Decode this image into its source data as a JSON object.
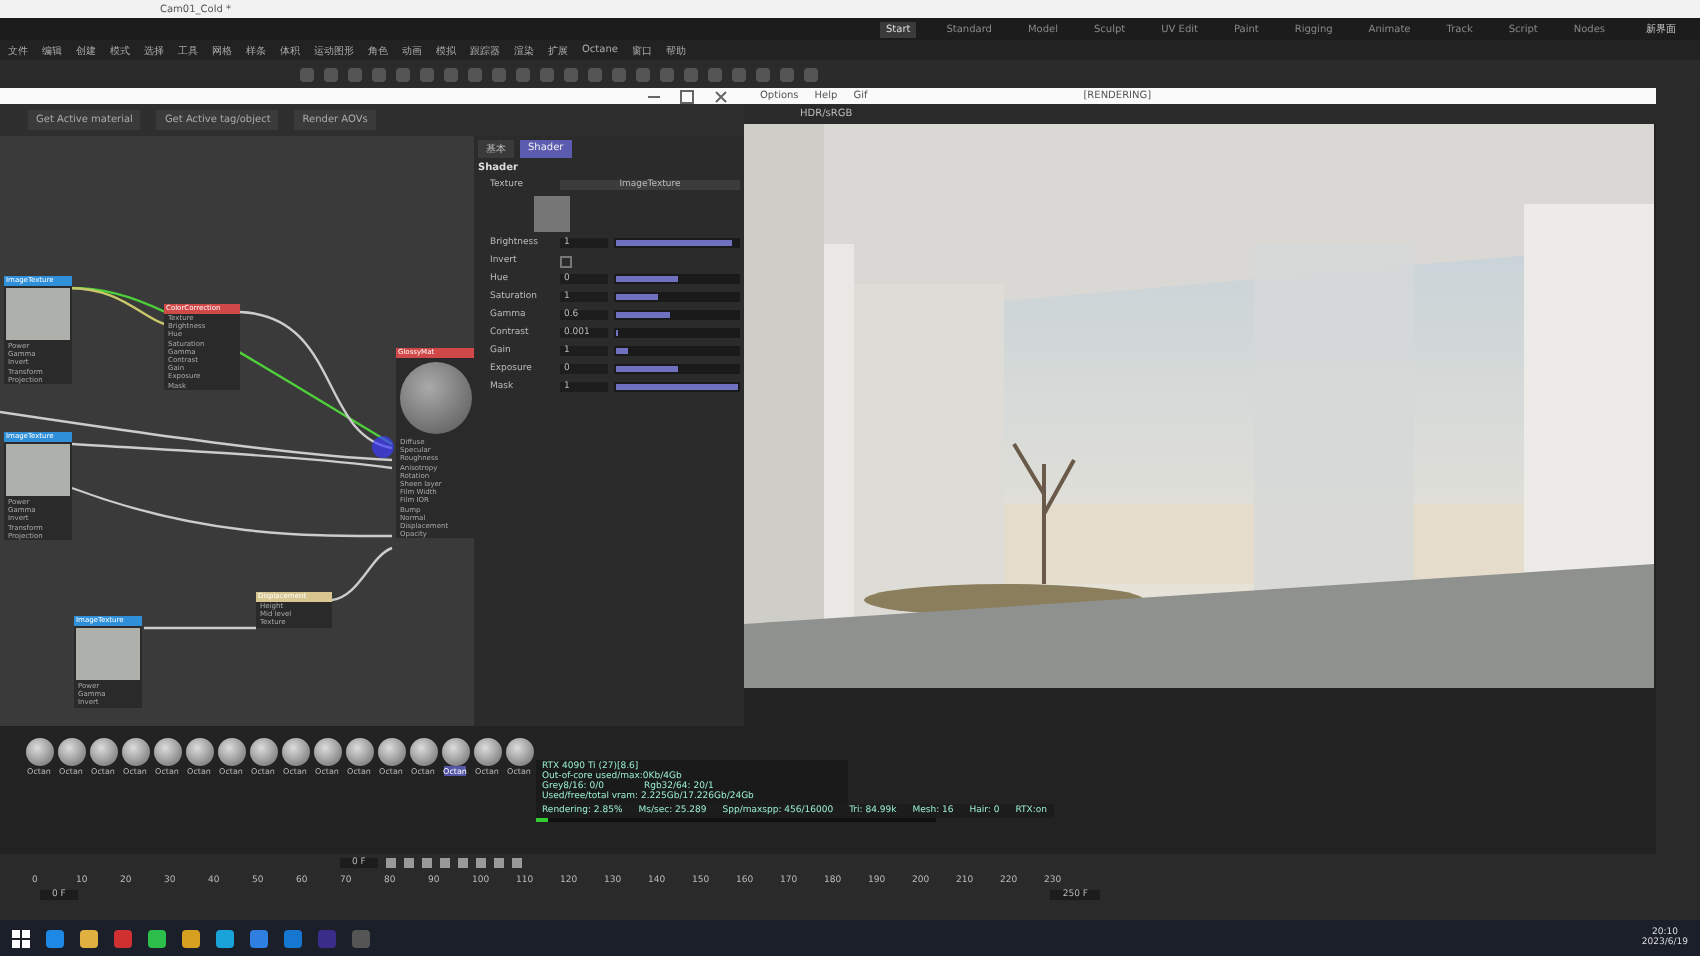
{
  "window": {
    "tab": "Cam01_Cold *"
  },
  "layouts": [
    {
      "label": "Start",
      "selected": true
    },
    {
      "label": "Standard",
      "selected": false
    },
    {
      "label": "Model",
      "selected": false
    },
    {
      "label": "Sculpt",
      "selected": false
    },
    {
      "label": "UV Edit",
      "selected": false
    },
    {
      "label": "Paint",
      "selected": false
    },
    {
      "label": "Rigging",
      "selected": false
    },
    {
      "label": "Animate",
      "selected": false
    },
    {
      "label": "Track",
      "selected": false
    },
    {
      "label": "Script",
      "selected": false
    },
    {
      "label": "Nodes",
      "selected": false
    }
  ],
  "layout_extra": "新界面",
  "menu": [
    "文件",
    "编辑",
    "创建",
    "模式",
    "选择",
    "工具",
    "网格",
    "样条",
    "体积",
    "运动图形",
    "角色",
    "动画",
    "模拟",
    "跟踪器",
    "渲染",
    "扩展",
    "Octane",
    "窗口",
    "帮助"
  ],
  "node_editor": {
    "buttons": [
      "Get Active material",
      "Get Active tag/object",
      "Render AOVs"
    ],
    "nodes": [
      {
        "title": "ImageTexture",
        "kind": "texture",
        "color": "#2f8fd8",
        "ports": [
          "Power",
          "Gamma",
          "Invert",
          "Transform",
          "Projection"
        ]
      },
      {
        "title": "ColorCorrection",
        "kind": "plain",
        "color": "#d04848",
        "ports": [
          "Texture",
          "Brightness",
          "Hue",
          "Saturation",
          "Gamma",
          "Contrast",
          "Gain",
          "Exposure",
          "Mask"
        ]
      },
      {
        "title": "ImageTexture",
        "kind": "texture",
        "color": "#2f8fd8",
        "ports": [
          "Power",
          "Gamma",
          "Invert",
          "Transform",
          "Projection"
        ]
      },
      {
        "title": "GlossyMat",
        "kind": "material",
        "color": "#d04848",
        "ports": [
          "Diffuse",
          "Specular",
          "Roughness",
          "Anisotropy",
          "Rotation",
          "Sheen layer",
          "Film Width",
          "Film IOR",
          "Bump",
          "Normal",
          "Displacement",
          "Opacity"
        ]
      },
      {
        "title": "Displacement",
        "kind": "plain",
        "color": "#d8c690",
        "ports": [
          "Height",
          "Mid level",
          "Texture"
        ]
      },
      {
        "title": "ImageTexture",
        "kind": "texture",
        "color": "#2f8fd8",
        "ports": [
          "Power",
          "Gamma",
          "Invert"
        ]
      }
    ]
  },
  "attributes": {
    "tabs": [
      {
        "label": "基本",
        "selected": false
      },
      {
        "label": "Shader",
        "selected": true
      }
    ],
    "heading": "Shader",
    "texture_label": "Texture",
    "texture_value": "ImageTexture",
    "params": [
      {
        "kind": "slider",
        "label": "Brightness",
        "value": "1",
        "level": 0.95
      },
      {
        "kind": "check",
        "label": "Invert",
        "checked": false
      },
      {
        "kind": "slider",
        "label": "Hue",
        "value": "0",
        "level": 0.5
      },
      {
        "kind": "slider",
        "label": "Saturation",
        "value": "1",
        "level": 0.35
      },
      {
        "kind": "slider",
        "label": "Gamma",
        "value": "0.6",
        "level": 0.45
      },
      {
        "kind": "slider",
        "label": "Contrast",
        "value": "0.001",
        "level": 0.02
      },
      {
        "kind": "slider",
        "label": "Gain",
        "value": "1",
        "level": 0.1
      },
      {
        "kind": "slider",
        "label": "Exposure",
        "value": "0",
        "level": 0.5
      },
      {
        "kind": "slider",
        "label": "Mask",
        "value": "1",
        "level": 1
      }
    ]
  },
  "viewer": {
    "menu": [
      "Options",
      "Help",
      "Gif"
    ],
    "title": "[RENDERING]",
    "mode": "HDR/sRGB"
  },
  "stats": [
    [
      "RTX 4090 Ti (27)[8.6]"
    ],
    [
      "Out-of-core used/max:0Kb/4Gb"
    ],
    [
      "Grey8/16: 0/0",
      "Rgb32/64: 20/1"
    ],
    [
      "Used/free/total vram: 2.225Gb/17.226Gb/24Gb"
    ]
  ],
  "status_line": [
    "Rendering: 2.85%",
    "Ms/sec: 25.289",
    "Spp/maxspp: 456/16000",
    "Tri: 84.99k",
    "Mesh: 16",
    "Hair: 0",
    "RTX:on"
  ],
  "render_progress": {
    "level": 0.03
  },
  "materials": [
    {
      "label": "Octan",
      "selected": false
    },
    {
      "label": "Octan",
      "selected": false
    },
    {
      "label": "Octan",
      "selected": false
    },
    {
      "label": "Octan",
      "selected": false
    },
    {
      "label": "Octan",
      "selected": false
    },
    {
      "label": "Octan",
      "selected": false
    },
    {
      "label": "Octan",
      "selected": false
    },
    {
      "label": "Octan",
      "selected": false
    },
    {
      "label": "Octan",
      "selected": false
    },
    {
      "label": "Octan",
      "selected": false
    },
    {
      "label": "Octan",
      "selected": false
    },
    {
      "label": "Octan",
      "selected": false
    },
    {
      "label": "Octan",
      "selected": false
    },
    {
      "label": "Octan",
      "selected": true
    },
    {
      "label": "Octan",
      "selected": false
    },
    {
      "label": "Octan",
      "selected": false
    }
  ],
  "timeline": {
    "ticks": [
      "0",
      "10",
      "20",
      "30",
      "40",
      "50",
      "60",
      "70",
      "80",
      "90",
      "100",
      "110",
      "120",
      "130",
      "140",
      "150",
      "160",
      "170",
      "180",
      "190",
      "200",
      "210",
      "220",
      "230"
    ],
    "current": "0 F",
    "start": "0 F",
    "end": "250 F"
  },
  "taskbar": {
    "time": "20:10",
    "date": "2023/6/19"
  }
}
